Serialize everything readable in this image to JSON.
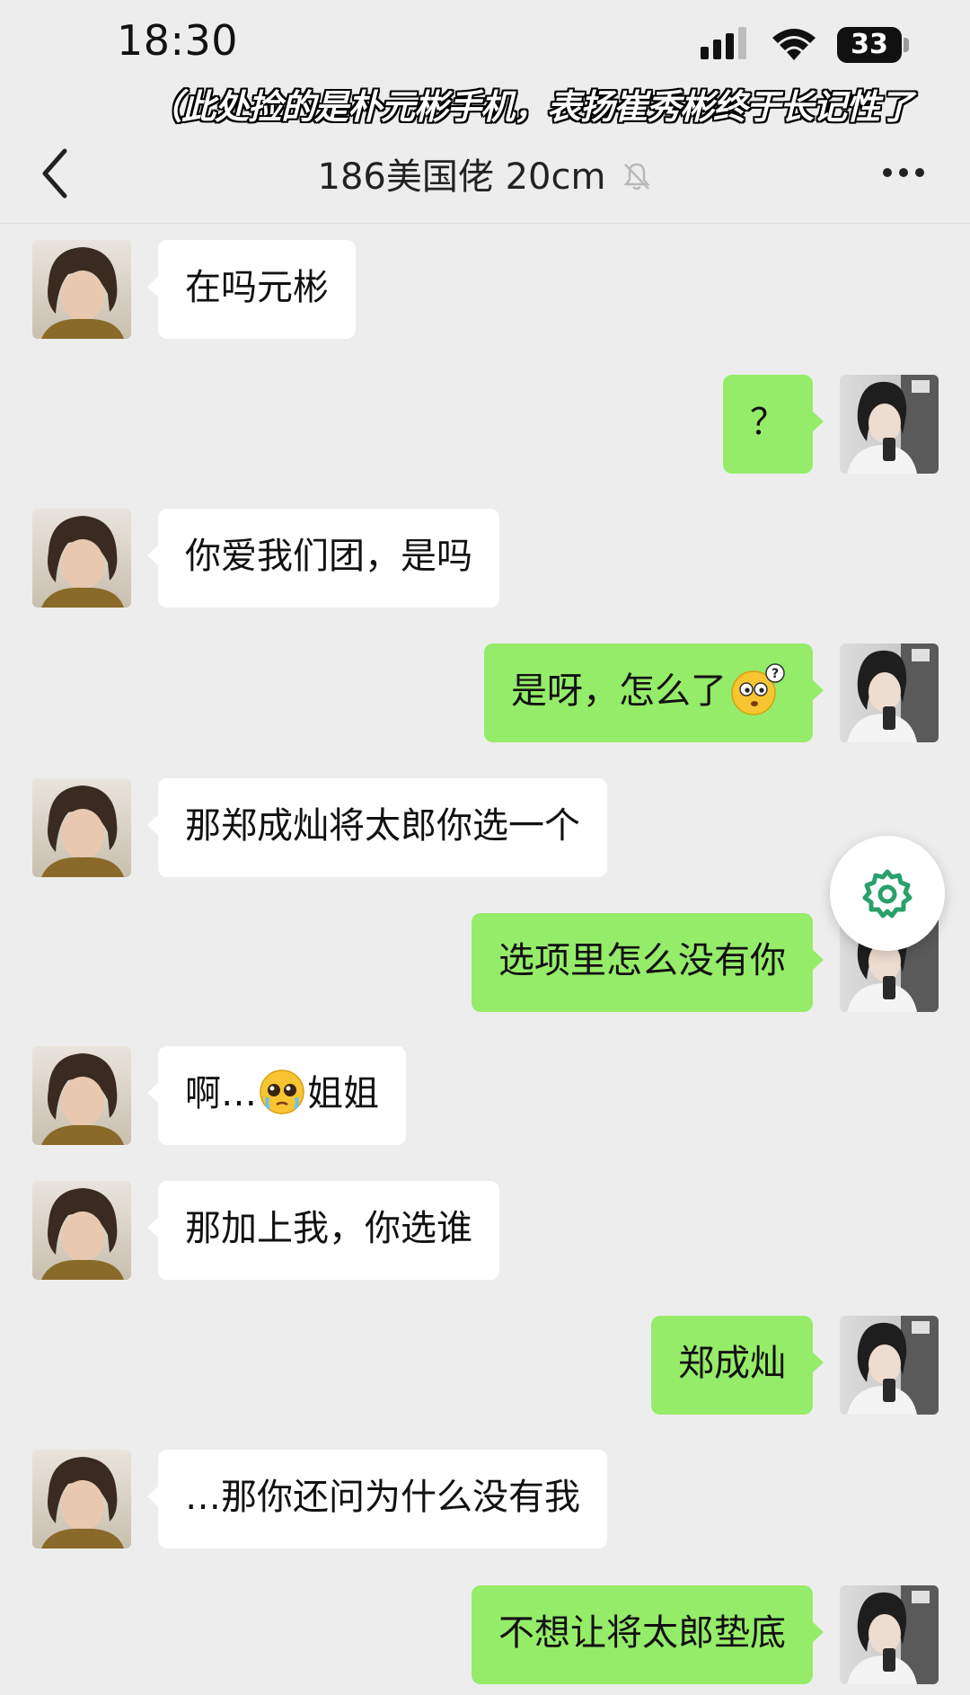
{
  "status_bar": {
    "time": "18:30",
    "battery": "33"
  },
  "caption": "（此处捡的是朴元彬手机，表扬崔秀彬终于长记性了",
  "header": {
    "title": "186美国佬 20cm"
  },
  "messages": [
    {
      "side": "in",
      "text": "在吗元彬"
    },
    {
      "side": "out",
      "text": "？"
    },
    {
      "side": "in",
      "text": "你爱我们团，是吗"
    },
    {
      "side": "out",
      "text": "是呀，怎么了",
      "emoji": "confused-emoji"
    },
    {
      "side": "in",
      "text": "那郑成灿将太郎你选一个"
    },
    {
      "side": "out",
      "text": "选项里怎么没有你"
    },
    {
      "side": "in",
      "text_before": "啊…",
      "text_after": "姐姐",
      "emoji": "pleading-emoji"
    },
    {
      "side": "in",
      "text": "那加上我，你选谁"
    },
    {
      "side": "out",
      "text": "郑成灿"
    },
    {
      "side": "in",
      "text": "…那你还问为什么没有我"
    },
    {
      "side": "out",
      "text": "不想让将太郎垫底"
    }
  ],
  "colors": {
    "outgoing_bubble": "#95ec69",
    "incoming_bubble": "#ffffff",
    "background": "#ededed",
    "gear_accent": "#2aa06a"
  },
  "icons": [
    "back-chevron-icon",
    "mute-bell-icon",
    "more-icon",
    "gear-icon",
    "signal-icon",
    "wifi-icon",
    "battery-icon"
  ]
}
